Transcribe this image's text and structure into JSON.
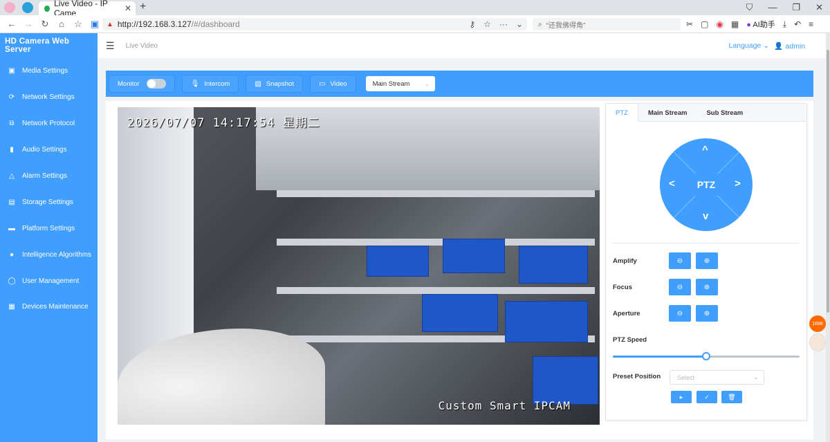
{
  "browser": {
    "tab_title": "Live Video - IP Came",
    "url_host": "http://192.168.3.127",
    "url_path": "/#/dashboard",
    "search_placeholder": "“还我佛得角”",
    "ai_label": "AI助手"
  },
  "app": {
    "brand": "HD Camera Web Server",
    "breadcrumb": "Live Video",
    "language": "Language",
    "user": "admin",
    "accent": "#409eff"
  },
  "sidebar": {
    "items": [
      {
        "label": "Media Settings",
        "icon": "image-icon"
      },
      {
        "label": "Network Settings",
        "icon": "network-icon"
      },
      {
        "label": "Network Protocol",
        "icon": "protocol-icon"
      },
      {
        "label": "Audio Settings",
        "icon": "microphone-icon"
      },
      {
        "label": "Alarm Settings",
        "icon": "bell-icon"
      },
      {
        "label": "Storage Settings",
        "icon": "storage-icon"
      },
      {
        "label": "Platform Settings",
        "icon": "monitor-icon"
      },
      {
        "label": "Intelligence Algorithms",
        "icon": "bulb-icon"
      },
      {
        "label": "User Management",
        "icon": "user-icon"
      },
      {
        "label": "Devices Maintenance",
        "icon": "grid-icon"
      }
    ]
  },
  "toolbar": {
    "monitor": "Monitor",
    "intercom": "Intercom",
    "snapshot": "Snapshot",
    "video": "Video",
    "stream_selected": "Main Stream"
  },
  "video": {
    "osd_time": "2026/07/07 14:17:54 星期二",
    "osd_name": "Custom Smart IPCAM"
  },
  "ptz": {
    "tabs": [
      "PTZ",
      "Main Stream",
      "Sub Stream"
    ],
    "center": "PTZ",
    "up": "^",
    "down": "v",
    "left": "<",
    "right": ">",
    "amplify": "Amplify",
    "focus": "Focus",
    "aperture": "Aperture",
    "speed_label": "PTZ Speed",
    "speed_value": 0.5,
    "preset_label": "Preset Position",
    "preset_placeholder": "Select"
  }
}
